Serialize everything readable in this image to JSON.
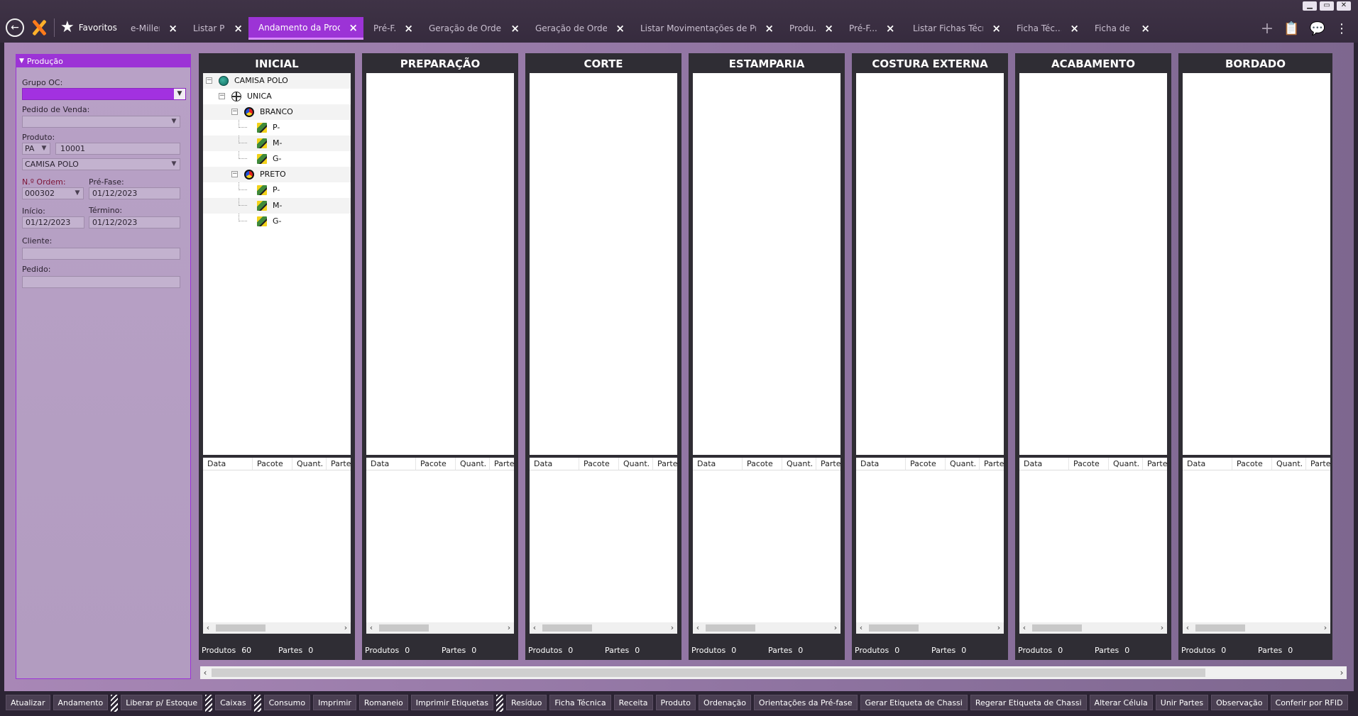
{
  "tabs": [
    {
      "label": "e-Millenni...",
      "active": false
    },
    {
      "label": "Listar Pré-F...",
      "active": false
    },
    {
      "label": "Andamento da Prod...",
      "active": true
    },
    {
      "label": "Pré-F...",
      "active": false
    },
    {
      "label": "Geração de Ordem de...",
      "active": false
    },
    {
      "label": "Geração de Ordem de...",
      "active": false
    },
    {
      "label": "Listar Movimentações de Pro...",
      "active": false
    },
    {
      "label": "Produ...",
      "active": false
    },
    {
      "label": "Pré-F...",
      "active": false
    },
    {
      "label": "Listar Fichas Técn...",
      "active": false
    },
    {
      "label": "Ficha Téc...",
      "active": false
    },
    {
      "label": "Ficha de C...",
      "active": false
    }
  ],
  "nav": {
    "favorites_label": "Favoritos"
  },
  "left_panel": {
    "title": "Produção",
    "grupo_oc_label": "Grupo OC:",
    "grupo_oc_value": "",
    "pedido_venda_label": "Pedido de Venda:",
    "pedido_venda_value": "",
    "produto_label": "Produto:",
    "produto_tipo": "PA",
    "produto_codigo": "10001",
    "produto_nome": "CAMISA POLO",
    "ordem_label": "N.º Ordem:",
    "ordem_value": "000302",
    "prefase_label": "Pré-Fase:",
    "prefase_value": "01/12/2023",
    "inicio_label": "Início:",
    "inicio_value": "01/12/2023",
    "termino_label": "Término:",
    "termino_value": "01/12/2023",
    "cliente_label": "Cliente:",
    "cliente_value": "",
    "pedido_label": "Pedido:",
    "pedido_value": ""
  },
  "grid_headers": [
    "Data",
    "Pacote",
    "Quant.",
    "Parte"
  ],
  "footer_labels": {
    "produtos": "Produtos",
    "partes": "Partes"
  },
  "columns": [
    {
      "title": "INICIAL",
      "produtos": "60",
      "partes": "0"
    },
    {
      "title": "PREPARAÇÃO",
      "produtos": "0",
      "partes": "0"
    },
    {
      "title": "CORTE",
      "produtos": "0",
      "partes": "0"
    },
    {
      "title": "ESTAMPARIA",
      "produtos": "0",
      "partes": "0"
    },
    {
      "title": "COSTURA EXTERNA",
      "produtos": "0",
      "partes": "0"
    },
    {
      "title": "ACABAMENTO",
      "produtos": "0",
      "partes": "0"
    },
    {
      "title": "BORDADO",
      "produtos": "0",
      "partes": "0"
    }
  ],
  "tree": [
    {
      "label": "CAMISA POLO",
      "level": 0,
      "icon": "globe-green",
      "expand": "−"
    },
    {
      "label": "UNICA",
      "level": 1,
      "icon": "globe-grid",
      "expand": "−"
    },
    {
      "label": "BRANCO",
      "level": 2,
      "icon": "color",
      "expand": "−"
    },
    {
      "label": "P-",
      "level": 3,
      "icon": "size",
      "expand": ""
    },
    {
      "label": "M-",
      "level": 3,
      "icon": "size",
      "expand": ""
    },
    {
      "label": "G-",
      "level": 3,
      "icon": "size",
      "expand": ""
    },
    {
      "label": "PRETO",
      "level": 2,
      "icon": "color",
      "expand": "−"
    },
    {
      "label": "P-",
      "level": 3,
      "icon": "size",
      "expand": ""
    },
    {
      "label": "M-",
      "level": 3,
      "icon": "size",
      "expand": ""
    },
    {
      "label": "G-",
      "level": 3,
      "icon": "size",
      "expand": ""
    }
  ],
  "bottom_buttons": [
    {
      "label": "Atualizar"
    },
    {
      "label": "Andamento",
      "grip_after": true
    },
    {
      "label": "Liberar p/ Estoque",
      "grip_after": true
    },
    {
      "label": "Caixas",
      "grip_after": true
    },
    {
      "label": "Consumo"
    },
    {
      "label": "Imprimir"
    },
    {
      "label": "Romaneio"
    },
    {
      "label": "Imprimir Etiquetas",
      "grip_after": true
    },
    {
      "label": "Resíduo"
    },
    {
      "label": "Ficha Técnica"
    },
    {
      "label": "Receita"
    },
    {
      "label": "Produto"
    },
    {
      "label": "Ordenação"
    },
    {
      "label": "Orientações da Pré-fase"
    },
    {
      "label": "Gerar Etiqueta de Chassi"
    },
    {
      "label": "Regerar Etiqueta de Chassi"
    },
    {
      "label": "Alterar Célula"
    },
    {
      "label": "Unir Partes"
    },
    {
      "label": "Observação"
    },
    {
      "label": "Conferir por RFID"
    }
  ],
  "colors": {
    "accent": "#9c33d6",
    "frame": "#2f2d34"
  },
  "icons": [
    "back-arrow-icon",
    "logo-icon",
    "star-icon",
    "close-icon",
    "add-tab-icon",
    "clipboard-icon",
    "chat-icon",
    "more-vert-icon"
  ]
}
